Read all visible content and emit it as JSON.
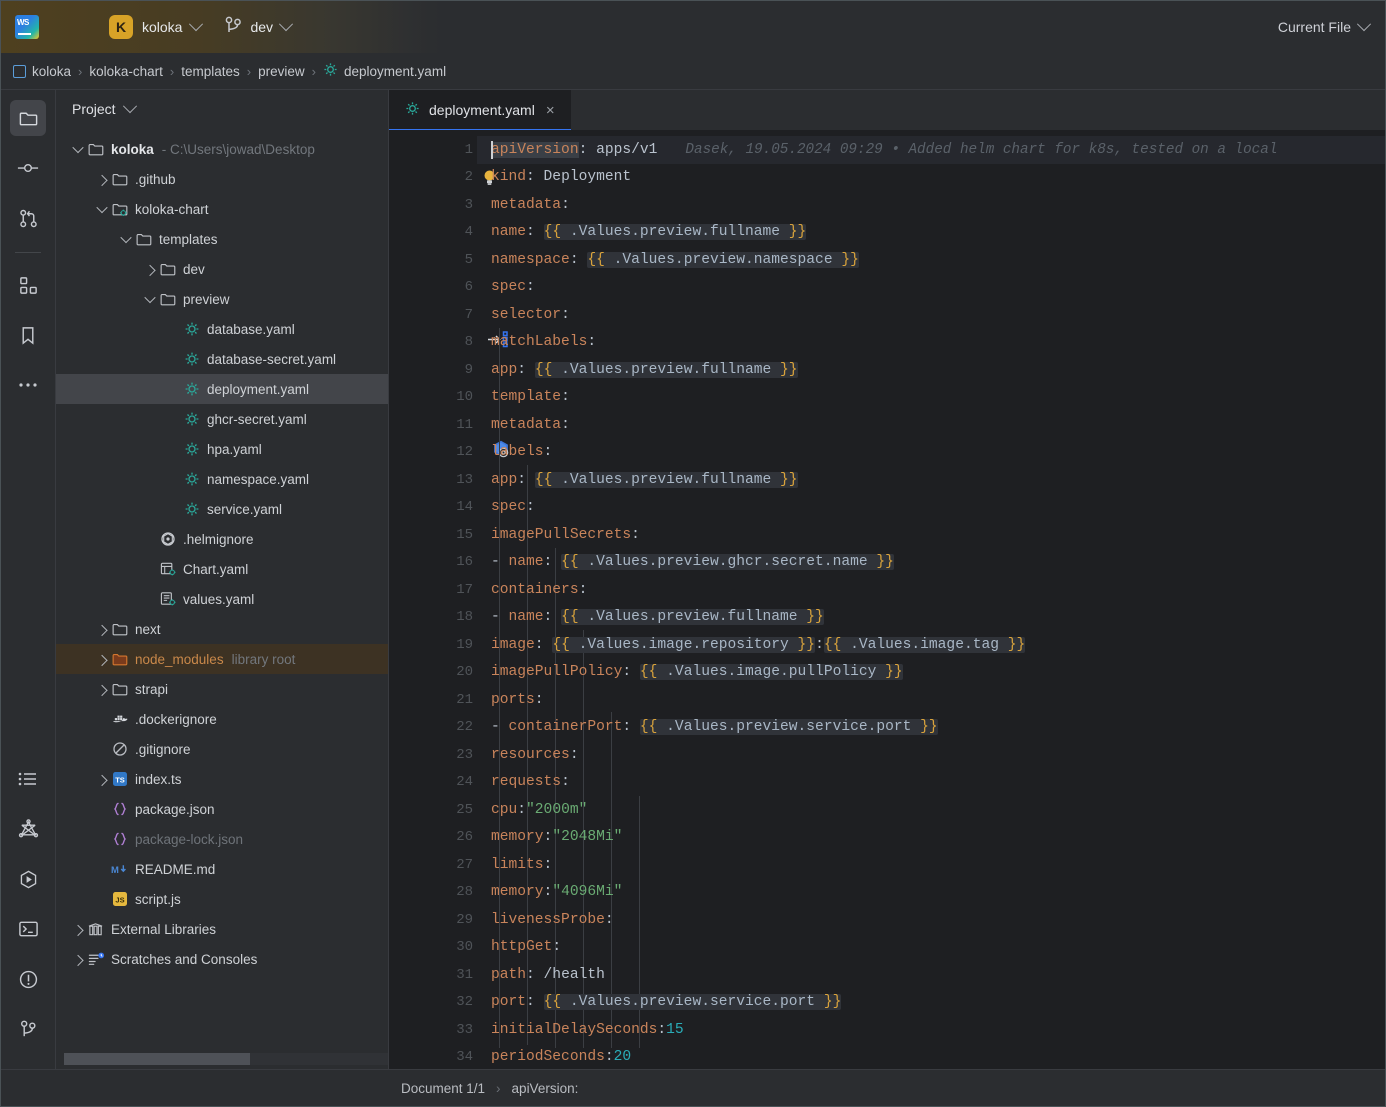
{
  "titlebar": {
    "logo_icon": "webstorm-logo-icon",
    "menu_icon": "hamburger-menu-icon",
    "project_badge": "K",
    "project_name": "koloka",
    "branch_icon": "git-branch-icon",
    "branch_name": "dev",
    "run_config": "Current File"
  },
  "breadcrumbs": {
    "items": [
      {
        "label": "koloka",
        "icon": "module-icon"
      },
      {
        "label": "koloka-chart",
        "icon": ""
      },
      {
        "label": "templates",
        "icon": ""
      },
      {
        "label": "preview",
        "icon": ""
      },
      {
        "label": "deployment.yaml",
        "icon": "kubernetes-file-icon"
      }
    ],
    "separator": "›"
  },
  "rail": {
    "top": [
      {
        "name": "project-view-icon",
        "active": true
      },
      {
        "name": "commit-icon",
        "active": false
      },
      {
        "name": "pull-requests-icon",
        "active": false
      }
    ],
    "mid": [
      {
        "name": "structure-icon",
        "active": false
      },
      {
        "name": "bookmarks-icon",
        "active": false
      },
      {
        "name": "more-tool-windows-icon",
        "active": false
      }
    ],
    "bottom": [
      {
        "name": "todo-icon",
        "active": false
      },
      {
        "name": "graphql-icon",
        "active": false
      },
      {
        "name": "run-icon",
        "active": false
      },
      {
        "name": "terminal-icon",
        "active": false
      },
      {
        "name": "problems-icon",
        "active": false
      },
      {
        "name": "version-control-icon",
        "active": false
      }
    ]
  },
  "project_panel": {
    "title": "Project",
    "tree": [
      {
        "depth": 0,
        "arrow": "down",
        "icon": "folder-icon",
        "label": "koloka",
        "bold": true,
        "sub": "- C:\\Users\\jowad\\Desktop"
      },
      {
        "depth": 1,
        "arrow": "right",
        "icon": "folder-icon",
        "label": ".github"
      },
      {
        "depth": 1,
        "arrow": "down",
        "icon": "helm-folder-icon",
        "label": "koloka-chart"
      },
      {
        "depth": 2,
        "arrow": "down",
        "icon": "folder-icon",
        "label": "templates"
      },
      {
        "depth": 3,
        "arrow": "right",
        "icon": "folder-icon",
        "label": "dev"
      },
      {
        "depth": 3,
        "arrow": "down",
        "icon": "folder-icon",
        "label": "preview"
      },
      {
        "depth": 4,
        "arrow": "none",
        "icon": "kubernetes-file-icon",
        "label": "database.yaml"
      },
      {
        "depth": 4,
        "arrow": "none",
        "icon": "kubernetes-file-icon",
        "label": "database-secret.yaml"
      },
      {
        "depth": 4,
        "arrow": "none",
        "icon": "kubernetes-file-icon",
        "label": "deployment.yaml",
        "selected": true
      },
      {
        "depth": 4,
        "arrow": "none",
        "icon": "kubernetes-file-icon",
        "label": "ghcr-secret.yaml"
      },
      {
        "depth": 4,
        "arrow": "none",
        "icon": "kubernetes-file-icon",
        "label": "hpa.yaml"
      },
      {
        "depth": 4,
        "arrow": "none",
        "icon": "kubernetes-file-icon",
        "label": "namespace.yaml"
      },
      {
        "depth": 4,
        "arrow": "none",
        "icon": "kubernetes-file-icon",
        "label": "service.yaml"
      },
      {
        "depth": 3,
        "arrow": "none",
        "icon": "helm-ignore-icon",
        "label": ".helmignore"
      },
      {
        "depth": 3,
        "arrow": "none",
        "icon": "helm-chart-icon",
        "label": "Chart.yaml"
      },
      {
        "depth": 3,
        "arrow": "none",
        "icon": "helm-values-icon",
        "label": "values.yaml"
      },
      {
        "depth": 1,
        "arrow": "right",
        "icon": "folder-icon",
        "label": "next"
      },
      {
        "depth": 1,
        "arrow": "right",
        "icon": "excluded-folder-icon",
        "label": "node_modules",
        "sub": "library root",
        "libroot": true
      },
      {
        "depth": 1,
        "arrow": "right",
        "icon": "folder-icon",
        "label": "strapi"
      },
      {
        "depth": 1,
        "arrow": "none",
        "icon": "docker-icon",
        "label": ".dockerignore"
      },
      {
        "depth": 1,
        "arrow": "none",
        "icon": "gitignore-icon",
        "label": ".gitignore"
      },
      {
        "depth": 1,
        "arrow": "right",
        "icon": "typescript-icon",
        "label": "index.ts"
      },
      {
        "depth": 1,
        "arrow": "none",
        "icon": "json-icon",
        "label": "package.json"
      },
      {
        "depth": 1,
        "arrow": "none",
        "icon": "json-icon",
        "label": "package-lock.json",
        "muted": true
      },
      {
        "depth": 1,
        "arrow": "none",
        "icon": "markdown-icon",
        "label": "README.md"
      },
      {
        "depth": 1,
        "arrow": "none",
        "icon": "javascript-icon",
        "label": "script.js"
      },
      {
        "depth": 0,
        "arrow": "right",
        "icon": "external-libraries-icon",
        "label": "External Libraries"
      },
      {
        "depth": 0,
        "arrow": "right",
        "icon": "scratches-icon",
        "label": "Scratches and Consoles"
      }
    ]
  },
  "editor": {
    "tab": {
      "label": "deployment.yaml",
      "icon": "kubernetes-file-icon",
      "close": "×"
    },
    "blame": "Dasek, 19.05.2024 09:29 • Added helm chart for k8s, tested on a local",
    "lines": [
      {
        "n": 1,
        "text": "apiVersion: apps/v1"
      },
      {
        "n": 2,
        "text": "kind: Deployment",
        "gutter_icon": "intention-bulb-icon"
      },
      {
        "n": 3,
        "text": "metadata:"
      },
      {
        "n": 4,
        "text": "  name: {{ .Values.preview.fullname }}"
      },
      {
        "n": 5,
        "text": "  namespace: {{ .Values.preview.namespace }}"
      },
      {
        "n": 6,
        "text": "spec:"
      },
      {
        "n": 7,
        "text": "  selector:"
      },
      {
        "n": 8,
        "text": "    matchLabels:",
        "gutter_icon": "k8s-navigate-icon"
      },
      {
        "n": 9,
        "text": "      app: {{ .Values.preview.fullname }}"
      },
      {
        "n": 10,
        "text": "  template:"
      },
      {
        "n": 11,
        "text": "    metadata:"
      },
      {
        "n": 12,
        "text": "      labels:",
        "gutter_icon": "kubernetes-icon"
      },
      {
        "n": 13,
        "text": "        app: {{ .Values.preview.fullname }}"
      },
      {
        "n": 14,
        "text": "    spec:"
      },
      {
        "n": 15,
        "text": "      imagePullSecrets:"
      },
      {
        "n": 16,
        "text": "        - name: {{ .Values.preview.ghcr.secret.name }}"
      },
      {
        "n": 17,
        "text": "      containers:"
      },
      {
        "n": 18,
        "text": "        - name: {{ .Values.preview.fullname }}"
      },
      {
        "n": 19,
        "text": "          image: {{ .Values.image.repository }}:{{ .Values.image.tag }}"
      },
      {
        "n": 20,
        "text": "          imagePullPolicy: {{ .Values.image.pullPolicy }}"
      },
      {
        "n": 21,
        "text": "          ports:"
      },
      {
        "n": 22,
        "text": "            - containerPort: {{ .Values.preview.service.port }}"
      },
      {
        "n": 23,
        "text": "          resources:"
      },
      {
        "n": 24,
        "text": "            requests:"
      },
      {
        "n": 25,
        "text": "              cpu: \"2000m\""
      },
      {
        "n": 26,
        "text": "              memory: \"2048Mi\""
      },
      {
        "n": 27,
        "text": "            limits:"
      },
      {
        "n": 28,
        "text": "              memory: \"4096Mi\""
      },
      {
        "n": 29,
        "text": "          livenessProbe:"
      },
      {
        "n": 30,
        "text": "            httpGet:"
      },
      {
        "n": 31,
        "text": "              path: /health"
      },
      {
        "n": 32,
        "text": "              port: {{ .Values.preview.service.port }}"
      },
      {
        "n": 33,
        "text": "            initialDelaySeconds: 15"
      },
      {
        "n": 34,
        "text": "            periodSeconds: 20"
      }
    ]
  },
  "statusbar": {
    "document": "Document 1/1",
    "separator": "›",
    "breadcrumb": "apiVersion:"
  },
  "colors": {
    "accent_blue": "#3574f0",
    "project_badge": "#d8a327",
    "yaml_key": "#c9845b",
    "yaml_string": "#6aab73",
    "yaml_number": "#2aacb8",
    "helm_brace": "#d9a33c",
    "library_root": "#3d3223",
    "editor_bg": "#1e1f22",
    "panel_bg": "#2b2d30"
  }
}
